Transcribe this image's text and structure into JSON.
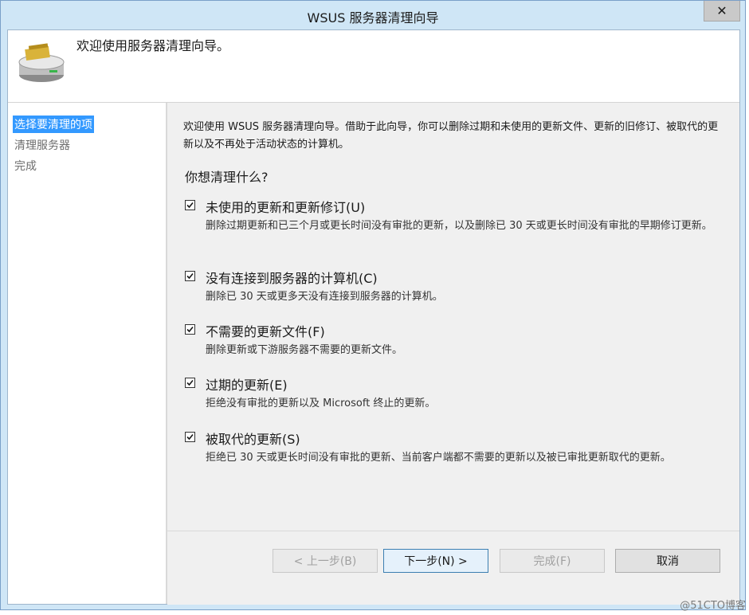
{
  "window": {
    "title": "WSUS 服务器清理向导",
    "close_glyph": "✕"
  },
  "header": {
    "title": "欢迎使用服务器清理向导。",
    "icon": "server-cleanup-icon"
  },
  "sidebar": {
    "items": [
      {
        "label": "选择要清理的项",
        "active": true
      },
      {
        "label": "清理服务器",
        "active": false
      },
      {
        "label": "完成",
        "active": false
      }
    ]
  },
  "main": {
    "intro": "欢迎使用 WSUS 服务器清理向导。借助于此向导，你可以删除过期和未使用的更新文件、更新的旧修订、被取代的更新以及不再处于活动状态的计算机。",
    "question": "你想清理什么?",
    "options": [
      {
        "label": "未使用的更新和更新修订(U)",
        "checked": true,
        "description": "删除过期更新和已三个月或更长时间没有审批的更新，以及删除已 30 天或更长时间没有审批的早期修订更新。"
      },
      {
        "label": "没有连接到服务器的计算机(C)",
        "checked": true,
        "description": "删除已 30 天或更多天没有连接到服务器的计算机。"
      },
      {
        "label": "不需要的更新文件(F)",
        "checked": true,
        "description": "删除更新或下游服务器不需要的更新文件。"
      },
      {
        "label": "过期的更新(E)",
        "checked": true,
        "description": "拒绝没有审批的更新以及 Microsoft 终止的更新。"
      },
      {
        "label": "被取代的更新(S)",
        "checked": true,
        "description": "拒绝已 30 天或更长时间没有审批的更新、当前客户端都不需要的更新以及被已审批更新取代的更新。"
      }
    ]
  },
  "buttons": {
    "back": "< 上一步(B)",
    "next": "下一步(N) >",
    "finish": "完成(F)",
    "cancel": "取消"
  },
  "watermark": "@51CTO博客"
}
